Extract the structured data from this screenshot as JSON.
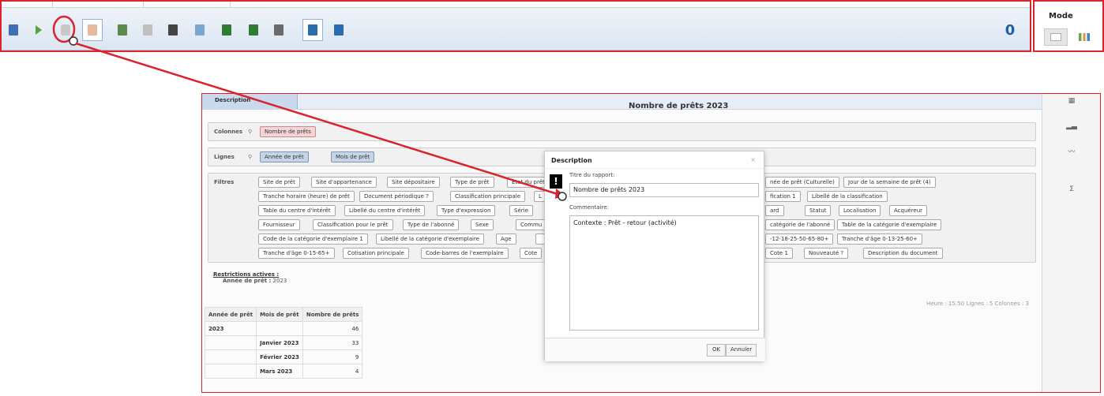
{
  "toolbar": {
    "count": "0"
  },
  "mode": {
    "title": "Mode"
  },
  "panel": {
    "desc_tab": "Description",
    "title": "Nombre de prêts 2023",
    "columns": {
      "label": "Colonnes",
      "chips": [
        "Nombre de prêts"
      ]
    },
    "lines": {
      "label": "Lignes",
      "chips": [
        "Année de prêt",
        "Mois de prêt"
      ]
    },
    "filters": {
      "label": "Filtres",
      "rows": [
        [
          "Site de prêt",
          "Site d'appartenance",
          "Site dépositaire",
          "Type de prêt",
          "Etat du prêt",
          "née de prêt (Culturelle)",
          "Jour de la semaine de prêt (4)"
        ],
        [
          "Tranche horaire (heure) de prêt",
          "Document périodique ?",
          "Classification principale",
          "L",
          "fication 1",
          "Libellé de la classification"
        ],
        [
          "Table du centre d'intérêt",
          "Libellé du centre d'intérêt",
          "Type d'expression",
          "Série",
          "ard",
          "Statut",
          "Localisation",
          "Acquéreur"
        ],
        [
          "Fournisseur",
          "Classification pour le prêt",
          "Type de l'abonné",
          "Sexe",
          "Commu",
          "catégorie de l'abonné",
          "Table de la catégorie d'exemplaire"
        ],
        [
          "Code de la catégorie d'exemplaire 1",
          "Libellé de la catégorie d'exemplaire",
          "Age",
          "",
          "-12-18-25-50-65-80+",
          "Tranche d'âge 0-13-25-60+"
        ],
        [
          "Tranche d'âge 0-15-65+",
          "Cotisation principale",
          "Code-barres de l'exemplaire",
          "Cote",
          "Cote 1",
          "Nouveauté ?",
          "Description du document"
        ]
      ]
    },
    "restrictions": {
      "title": "Restrictions actives :",
      "field": "Année de prêt :",
      "value": "2023"
    },
    "status": "Heure : 15:50   Lignes : 5   Colonnes : 3",
    "table": {
      "headers": [
        "Année de prêt",
        "Mois de prêt",
        "Nombre de prêts"
      ],
      "rows": [
        [
          "2023",
          "",
          "46"
        ],
        [
          "",
          "Janvier 2023",
          "33"
        ],
        [
          "",
          "Février 2023",
          "9"
        ],
        [
          "",
          "Mars 2023",
          "4"
        ]
      ]
    }
  },
  "dialog": {
    "title": "Description",
    "close": "×",
    "label1": "Titre du rapport:",
    "value1": "Nombre de prêts 2023",
    "label2": "Commentaire:",
    "value2": "Contexte : Prêt - retour (activité)",
    "ok": "OK",
    "cancel": "Annuler"
  },
  "side": {
    "sigma": "Σ"
  }
}
